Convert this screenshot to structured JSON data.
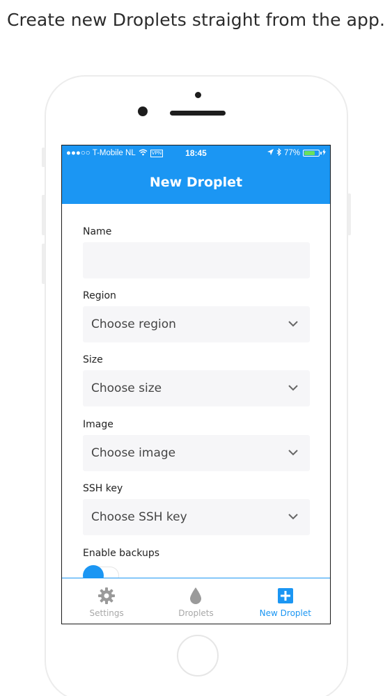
{
  "headline": "Create new Droplets straight from the app.",
  "colors": {
    "accent": "#1b96f3",
    "field_bg": "#f6f6f8",
    "inactive": "#a8a8a8"
  },
  "status_bar": {
    "carrier": "●●●○○ T-Mobile NL",
    "wifi_icon": "wifi-icon",
    "vpn": "VPN",
    "time": "18:45",
    "battery_percent": "77%",
    "battery_level": 0.77
  },
  "nav": {
    "title": "New Droplet"
  },
  "form": {
    "name": {
      "label": "Name",
      "value": ""
    },
    "region": {
      "label": "Region",
      "placeholder": "Choose region"
    },
    "size": {
      "label": "Size",
      "placeholder": "Choose size"
    },
    "image": {
      "label": "Image",
      "placeholder": "Choose image"
    },
    "ssh_key": {
      "label": "SSH key",
      "placeholder": "Choose SSH key"
    },
    "backups": {
      "label": "Enable backups"
    }
  },
  "tabs": [
    {
      "label": "Settings",
      "icon": "gear-icon",
      "active": false
    },
    {
      "label": "Droplets",
      "icon": "droplet-icon",
      "active": false
    },
    {
      "label": "New Droplet",
      "icon": "plus-square-icon",
      "active": true
    }
  ]
}
